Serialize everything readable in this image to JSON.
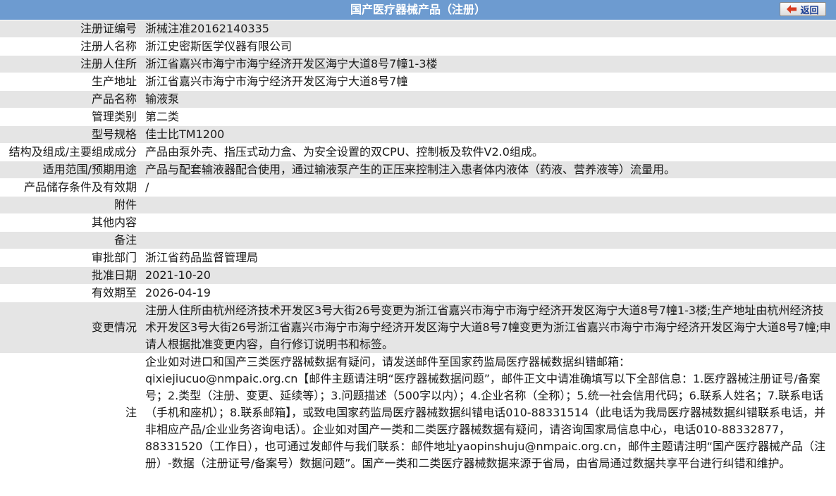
{
  "header": {
    "title": "国产医疗器械产品（注册）",
    "back_label": "返回"
  },
  "rows": [
    {
      "label": "注册证编号",
      "value": "浙械注准20162140335"
    },
    {
      "label": "注册人名称",
      "value": "浙江史密斯医学仪器有限公司"
    },
    {
      "label": "注册人住所",
      "value": "浙江省嘉兴市海宁市海宁经济开发区海宁大道8号7幢1-3楼"
    },
    {
      "label": "生产地址",
      "value": "浙江省嘉兴市海宁市海宁经济开发区海宁大道8号7幢"
    },
    {
      "label": "产品名称",
      "value": "输液泵"
    },
    {
      "label": "管理类别",
      "value": "第二类"
    },
    {
      "label": "型号规格",
      "value": "佳士比TM1200"
    },
    {
      "label": "结构及组成/主要组成成分",
      "value": "产品由泵外壳、指压式动力盒、为安全设置的双CPU、控制板及软件V2.0组成。"
    },
    {
      "label": "适用范围/预期用途",
      "value": "产品与配套输液器配合使用，通过输液泵产生的正压来控制注入患者体内液体（药液、营养液等）流量用。"
    },
    {
      "label": "产品储存条件及有效期",
      "value": "/"
    },
    {
      "label": "附件",
      "value": ""
    },
    {
      "label": "其他内容",
      "value": ""
    },
    {
      "label": "备注",
      "value": ""
    },
    {
      "label": "审批部门",
      "value": "浙江省药品监督管理局"
    },
    {
      "label": "批准日期",
      "value": "2021-10-20"
    },
    {
      "label": "有效期至",
      "value": "2026-04-19"
    },
    {
      "label": "变更情况",
      "value": "注册人住所由杭州经济技术开发区3号大街26号变更为浙江省嘉兴市海宁市海宁经济开发区海宁大道8号7幢1-3楼;生产地址由杭州经济技术开发区3号大街26号浙江省嘉兴市海宁市海宁经济开发区海宁大道8号7幢变更为浙江省嘉兴市海宁市海宁经济开发区海宁大道8号7幢;申请人根据批准变更内容，自行修订说明书和标签。"
    }
  ],
  "notice": {
    "label": "注",
    "line1": "企业如对进口和国产三类医疗器械数据有疑问，请发送邮件至国家药监局医疗器械数据纠错邮箱：",
    "line2": "qixiejiucuo@nmpaic.org.cn【邮件主题请注明“医疗器械数据问题”，邮件正文中请准确填写以下全部信息：1.医疗器械注册证号/备案号；2.类型（注册、变更、延续等）；3.问题描述（500字以内）；4.企业名称（全称）；5.统一社会信用代码；6.联系人姓名；7.联系电话（手机和座机）；8.联系邮箱】，或致电国家药监局医疗器械数据纠错电话010-88331514（此电话为我局医疗器械数据纠错联系电话，并非相应产品/企业业务咨询电话）。企业如对国产一类和二类医疗器械数据有疑问，请咨询国家局信息中心，电话010-88332877，88331520（工作日），也可通过发邮件与我们联系：邮件地址yaopinshuju@nmpaic.org.cn，邮件主题请注明“国产医疗器械产品（注册）-数据（注册证号/备案号）数据问题”。国产一类和二类医疗器械数据来源于省局，由省局通过数据共享平台进行纠错和维护。"
  }
}
